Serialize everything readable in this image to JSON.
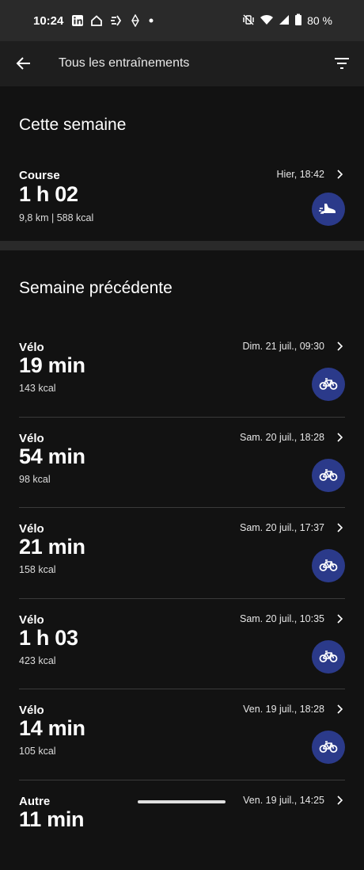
{
  "status": {
    "time": "10:24",
    "battery": "80 %"
  },
  "header": {
    "title": "Tous les entraînements"
  },
  "sections": [
    {
      "title": "Cette semaine",
      "items": [
        {
          "type": "Course",
          "duration": "1 h 02",
          "details": "9,8 km | 588 kcal",
          "date": "Hier, 18:42",
          "icon": "running-shoe-icon"
        }
      ]
    },
    {
      "title": "Semaine précédente",
      "items": [
        {
          "type": "Vélo",
          "duration": "19 min",
          "details": "143 kcal",
          "date": "Dim. 21 juil., 09:30",
          "icon": "bicycle-icon"
        },
        {
          "type": "Vélo",
          "duration": "54 min",
          "details": "98 kcal",
          "date": "Sam. 20 juil., 18:28",
          "icon": "bicycle-icon"
        },
        {
          "type": "Vélo",
          "duration": "21 min",
          "details": "158 kcal",
          "date": "Sam. 20 juil., 17:37",
          "icon": "bicycle-icon"
        },
        {
          "type": "Vélo",
          "duration": "1 h 03",
          "details": "423 kcal",
          "date": "Sam. 20 juil., 10:35",
          "icon": "bicycle-icon"
        },
        {
          "type": "Vélo",
          "duration": "14 min",
          "details": "105 kcal",
          "date": "Ven. 19 juil., 18:28",
          "icon": "bicycle-icon"
        },
        {
          "type": "Autre",
          "duration": "11 min",
          "details": "",
          "date": "Ven. 19 juil., 14:25",
          "icon": "activity-icon"
        }
      ]
    }
  ],
  "colors": {
    "badge": "#2b3a8a",
    "background": "#121212",
    "statusbar": "#2a2a2a"
  }
}
